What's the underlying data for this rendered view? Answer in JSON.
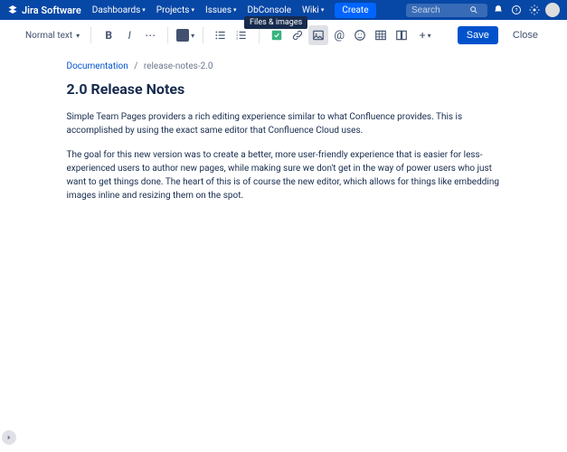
{
  "nav": {
    "product": "Jira Software",
    "items": [
      {
        "label": "Dashboards",
        "hasDropdown": true
      },
      {
        "label": "Projects",
        "hasDropdown": true
      },
      {
        "label": "Issues",
        "hasDropdown": true
      },
      {
        "label": "DbConsole",
        "hasDropdown": false
      },
      {
        "label": "Wiki",
        "hasDropdown": true
      }
    ],
    "create": "Create",
    "search_placeholder": "Search"
  },
  "tooltip": "Files & images",
  "toolbar": {
    "text_style": "Normal text",
    "save": "Save",
    "close": "Close"
  },
  "breadcrumb": {
    "parent": "Documentation",
    "current": "release-notes-2.0"
  },
  "document": {
    "title": "2.0 Release Notes",
    "p1": "Simple Team Pages providers a rich editing experience similar to what Confluence provides. This is accomplished by using the exact same editor that Confluence Cloud uses.",
    "p2": "The goal for this new version was to create a better, more user-friendly experience that is easier for less-experienced users to author new pages, while making sure we don't get in the way of power users who just want to get things done. The heart of this is of course the new editor, which allows for things like embedding images inline and resizing them on the spot."
  }
}
